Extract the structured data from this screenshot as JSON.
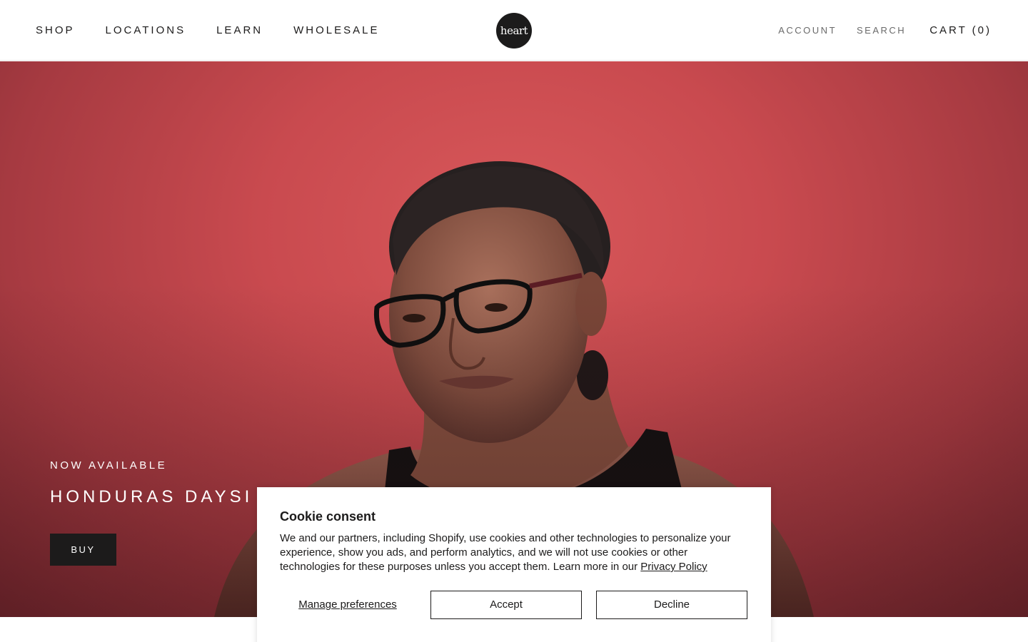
{
  "header": {
    "nav_left": [
      {
        "label": "SHOP"
      },
      {
        "label": "LOCATIONS"
      },
      {
        "label": "LEARN"
      },
      {
        "label": "WHOLESALE"
      }
    ],
    "logo_text": "heart",
    "account_label": "ACCOUNT",
    "search_label": "SEARCH",
    "cart_label": "CART (0)"
  },
  "hero": {
    "eyebrow": "NOW AVAILABLE",
    "title": "HONDURAS DAYSI M",
    "buy_label": "BUY",
    "background_color": "#c94a4f"
  },
  "cookie": {
    "title": "Cookie consent",
    "body": "We and our partners, including Shopify, use cookies and other technologies to personalize your experience, show you ads, and perform analytics, and we will not use cookies or other technologies for these purposes unless you accept them. Learn more in our ",
    "privacy_link": "Privacy Policy",
    "manage_label": "Manage preferences",
    "accept_label": "Accept",
    "decline_label": "Decline"
  }
}
